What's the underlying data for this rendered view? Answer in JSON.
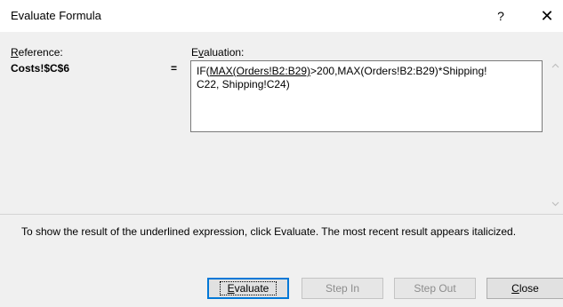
{
  "window": {
    "title": "Evaluate Formula",
    "help_label": "?",
    "close_glyph": "✕"
  },
  "reference": {
    "label_prefix": "",
    "label_accel": "R",
    "label_rest": "eference:",
    "value": "Costs!$C$6"
  },
  "evaluation": {
    "label_accel_pre": "E",
    "label_accel": "v",
    "label_rest": "aluation:",
    "equals": "=",
    "line1_pre": "IF(",
    "line1_underlined": "MAX(Orders!B2:B29)",
    "line1_post": ">200,MAX(Orders!B2:B29)*Shipping!",
    "line2": "C22, Shipping!C24)"
  },
  "hint": {
    "text": "To show the result of the underlined expression, click Evaluate.  The most recent result appears italicized."
  },
  "buttons": {
    "evaluate_accel": "E",
    "evaluate_rest": "valuate",
    "step_in": "Step In",
    "step_out": "Step Out",
    "close_accel": "C",
    "close_rest": "lose"
  },
  "colors": {
    "dialog_bg": "#f0f0f0",
    "default_button_border": "#0078d7",
    "disabled_text": "#8d8d8d"
  }
}
